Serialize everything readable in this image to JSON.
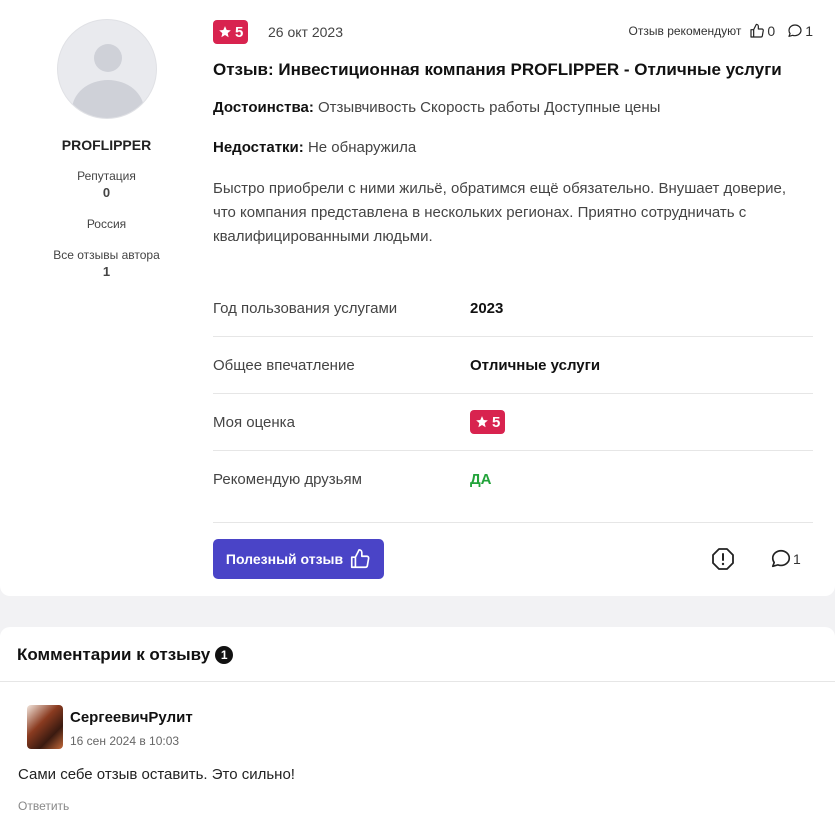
{
  "author": {
    "name": "PROFLIPPER",
    "reputation_label": "Репутация",
    "reputation_value": "0",
    "country": "Россия",
    "all_reviews_label": "Все отзывы автора",
    "all_reviews_value": "1"
  },
  "review": {
    "rating": "5",
    "date": "26 окт 2023",
    "recommend_label": "Отзыв рекомендуют",
    "likes": "0",
    "comments_count": "1",
    "title": "Отзыв: Инвестиционная компания PROFLIPPER - Отличные услуги",
    "pros_label": "Достоинства:",
    "pros_text": "Отзывчивость Скорость работы Доступные цены",
    "cons_label": "Недостатки:",
    "cons_text": "Не обнаружила",
    "text": "Быстро приобрели с ними жильё, обратимся ещё обязательно. Внушает доверие, что компания представлена в нескольких регионах. Приятно сотрудничать с квалифицированными людьми."
  },
  "details": {
    "year_label": "Год пользования услугами",
    "year_value": "2023",
    "impression_label": "Общее впечатление",
    "impression_value": "Отличные услуги",
    "my_rating_label": "Моя оценка",
    "my_rating_value": "5",
    "recommend_label": "Рекомендую друзьям",
    "recommend_value": "ДА"
  },
  "actions": {
    "helpful_label": "Полезный отзыв",
    "comments_count": "1"
  },
  "comments": {
    "header": "Комментарии к отзыву",
    "count": "1",
    "items": [
      {
        "author": "СергеевичРулит",
        "date": "16 сен 2024 в 10:03",
        "text": "Сами себе отзыв оставить. Это сильно!",
        "reply_label": "Ответить"
      }
    ]
  },
  "colors": {
    "rating_badge": "#d8234f",
    "helpful_button": "#4a44c7",
    "yes_green": "#22a33a"
  }
}
